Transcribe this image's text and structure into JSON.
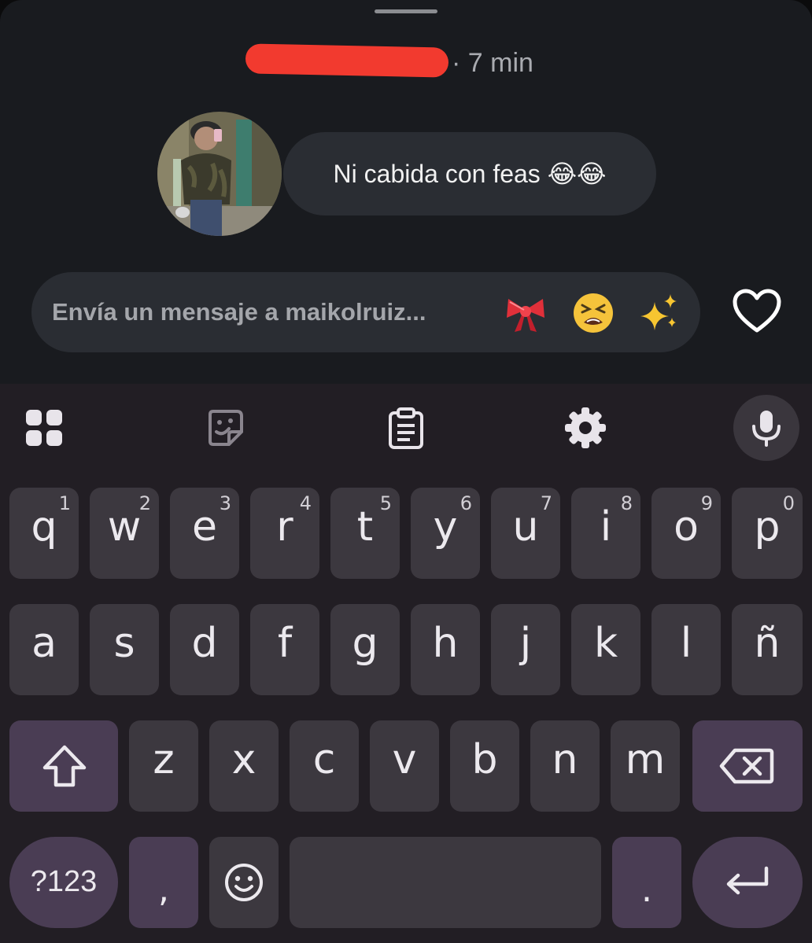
{
  "message_thread": {
    "time_ago": "· 7 min",
    "message_text": "Ni cabida con feas 😂😂"
  },
  "composer": {
    "placeholder": "Envía un mensaje a maikolruiz...",
    "quick_emojis": [
      "ribbon",
      "tired-face",
      "sparkles"
    ]
  },
  "keyboard": {
    "toolbar": [
      "apps-grid-icon",
      "sticker-icon",
      "clipboard-icon",
      "settings-gear-icon",
      "mic-icon"
    ],
    "row1": [
      {
        "key": "q",
        "alt": "1"
      },
      {
        "key": "w",
        "alt": "2"
      },
      {
        "key": "e",
        "alt": "3"
      },
      {
        "key": "r",
        "alt": "4"
      },
      {
        "key": "t",
        "alt": "5"
      },
      {
        "key": "y",
        "alt": "6"
      },
      {
        "key": "u",
        "alt": "7"
      },
      {
        "key": "i",
        "alt": "8"
      },
      {
        "key": "o",
        "alt": "9"
      },
      {
        "key": "p",
        "alt": "0"
      }
    ],
    "row2": [
      "a",
      "s",
      "d",
      "f",
      "g",
      "h",
      "j",
      "k",
      "l",
      "ñ"
    ],
    "row3": [
      "z",
      "x",
      "c",
      "v",
      "b",
      "n",
      "m"
    ],
    "row4": {
      "symbols": "?123",
      "comma": ",",
      "period": "."
    }
  },
  "colors": {
    "sheet_bg": "#191b1f",
    "bubble_bg": "#2a2d33",
    "keyboard_bg": "#221e24",
    "key_bg": "#3c383f",
    "modifier_key_bg": "#4a3d54",
    "redaction": "#f23a2f"
  }
}
